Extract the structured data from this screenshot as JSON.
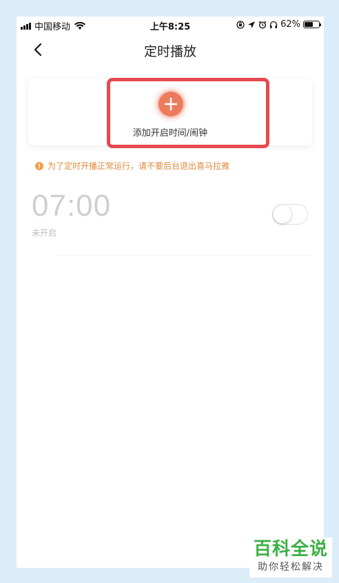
{
  "status_bar": {
    "carrier": "中国移动",
    "time": "上午8:25",
    "battery_percent": "62%",
    "battery_level": 0.62
  },
  "nav": {
    "title": "定时播放"
  },
  "add_card": {
    "label": "添加开启时间/闹钟"
  },
  "notice": {
    "text": "为了定时开播正常运行，请不要后台退出喜马拉雅"
  },
  "alarm": {
    "time": "07:00",
    "status": "未开启",
    "enabled": false
  },
  "watermark": {
    "main": "百科全说",
    "sub": "助你轻松解决"
  },
  "colors": {
    "accent": "#ec7b5e",
    "highlight": "#e8484f",
    "notice": "#e08a3c",
    "watermark": "#3cb043"
  }
}
